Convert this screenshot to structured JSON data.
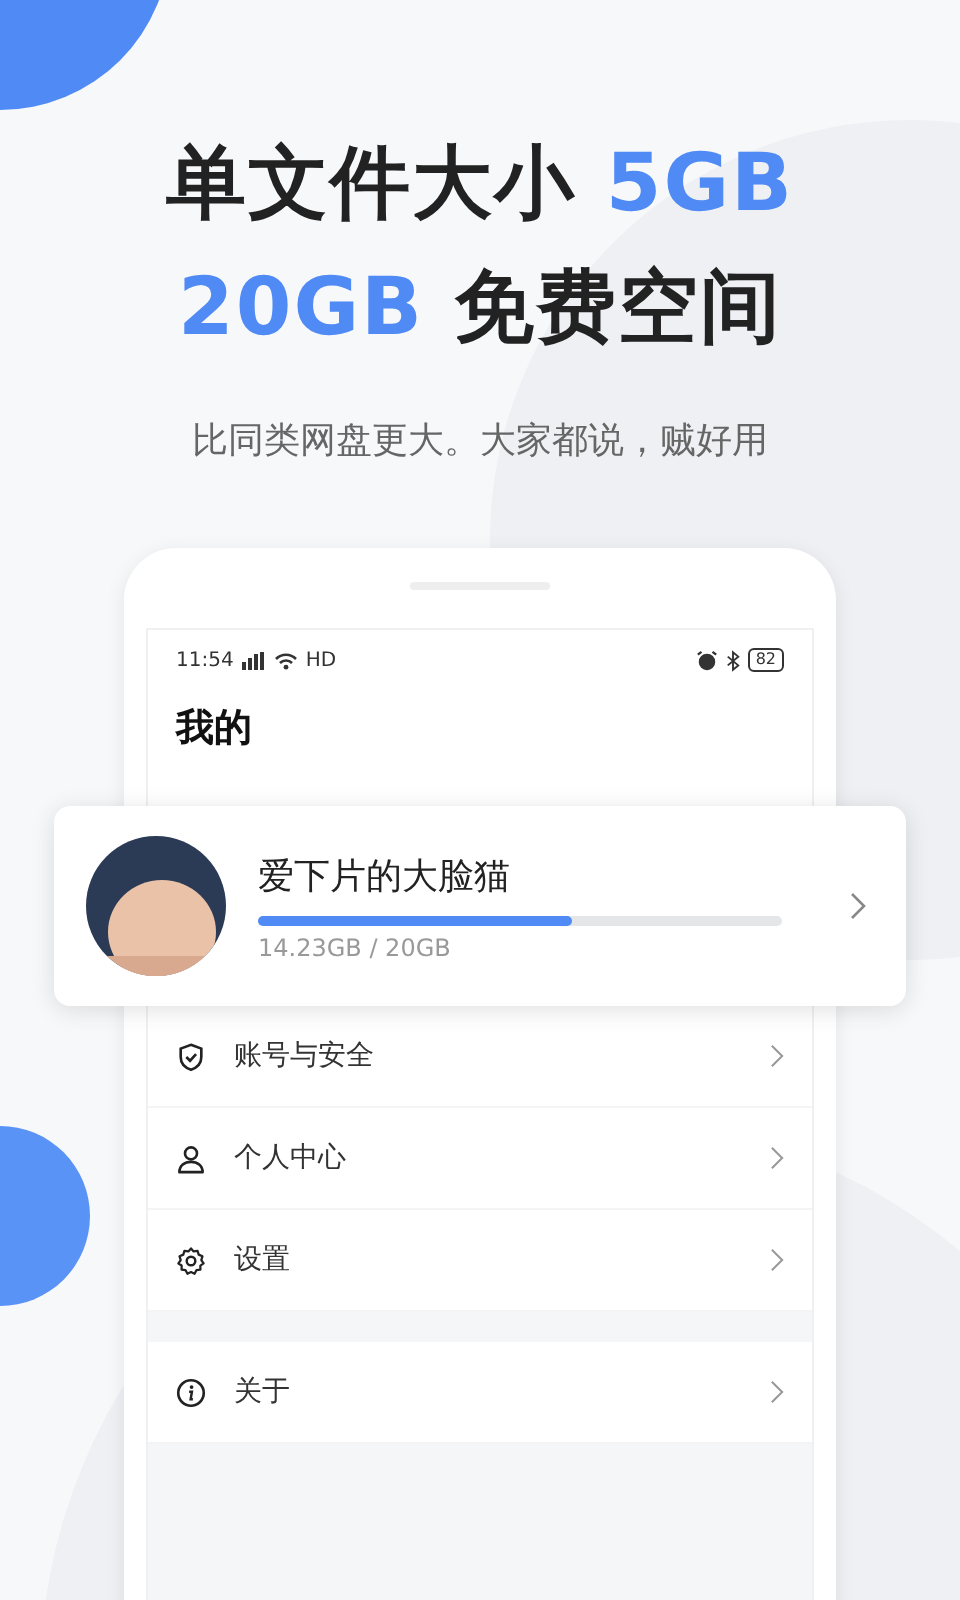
{
  "headline": [
    [
      {
        "text": "单文件大小 ",
        "highlight": false
      },
      {
        "text": "5GB",
        "highlight": true
      }
    ],
    [
      {
        "text": "20GB",
        "highlight": true
      },
      {
        "text": " 免费空间",
        "highlight": false
      }
    ]
  ],
  "subtitle": "比同类网盘更大。大家都说，贼好用",
  "status_bar": {
    "time": "11:54",
    "network": "HD",
    "battery": "82"
  },
  "page_title": "我的",
  "profile": {
    "name": "爱下片的大脸猫",
    "level": 0.6,
    "usage": "14.23GB / 20GB"
  },
  "menu_groups": [
    [
      {
        "kind": "shield",
        "label": "账号与安全"
      },
      {
        "kind": "person",
        "label": "个人中心"
      },
      {
        "kind": "gear",
        "label": "设置"
      }
    ],
    [
      {
        "kind": "info",
        "label": "关于"
      }
    ]
  ]
}
